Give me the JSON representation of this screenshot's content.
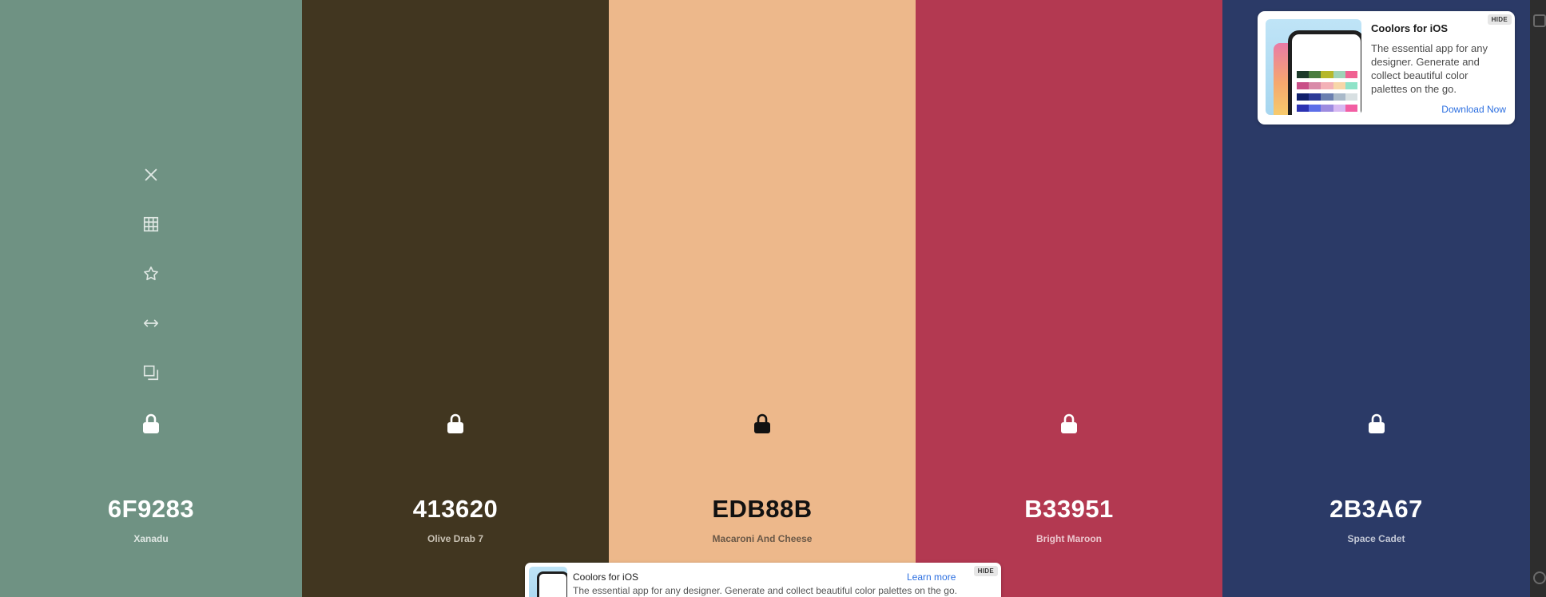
{
  "columns": [
    {
      "hex": "6F9283",
      "name": "Xanadu",
      "bg": "#6F9283",
      "text": "#ffffff",
      "name_color": "#dfe7e3",
      "lock_color": "#ffffff",
      "tool_color": "#dfe7e3",
      "width": 378
    },
    {
      "hex": "413620",
      "name": "Olive Drab 7",
      "bg": "#413620",
      "text": "#ffffff",
      "name_color": "#c9c2b4",
      "lock_color": "#ffffff",
      "width": 384
    },
    {
      "hex": "EDB88B",
      "name": "Macaroni And Cheese",
      "bg": "#EDB88B",
      "text": "#111111",
      "name_color": "#6a5847",
      "lock_color": "#111111",
      "width": 384
    },
    {
      "hex": "B33951",
      "name": "Bright Maroon",
      "bg": "#B33951",
      "text": "#ffffff",
      "name_color": "#ecc7ce",
      "lock_color": "#ffffff",
      "width": 384
    },
    {
      "hex": "2B3A67",
      "name": "Space Cadet",
      "bg": "#2B3A67",
      "text": "#ffffff",
      "name_color": "#c3c8d6",
      "lock_color": "#ffffff",
      "width": 385
    }
  ],
  "tools": [
    {
      "name": "remove-color-icon",
      "icon": "x"
    },
    {
      "name": "view-shades-icon",
      "icon": "grid"
    },
    {
      "name": "save-color-icon",
      "icon": "star"
    },
    {
      "name": "drag-color-icon",
      "icon": "arrows-h"
    },
    {
      "name": "copy-hex-icon",
      "icon": "copy"
    }
  ],
  "ad_top": {
    "title": "Coolors for iOS",
    "text": "The essential app for any designer. Generate and collect beautiful color palettes on the go.",
    "cta": "Download Now",
    "hide": "HIDE"
  },
  "ad_bottom": {
    "title": "Coolors for iOS",
    "text": "The essential app for any designer. Generate and collect beautiful color palettes on the go.",
    "cta": "Learn more",
    "hide": "HIDE"
  }
}
